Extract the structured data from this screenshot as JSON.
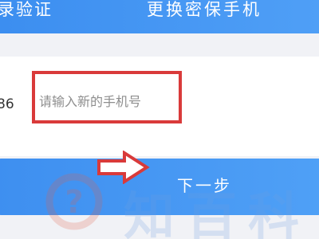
{
  "header": {
    "steps": [
      "录验证",
      "更换密保手机"
    ]
  },
  "form": {
    "country_code": "86",
    "phone_placeholder": "请输入新的手机号"
  },
  "next_button": {
    "label": "下一步"
  },
  "watermark": {
    "text": "知百科",
    "logo_glyph": "?"
  },
  "colors": {
    "header_blue": "#3c8ef0",
    "button_blue": "#4fa0f6",
    "annotation_red": "#d93a3a",
    "page_bg": "#f1f2f6"
  },
  "icons": {
    "annotation_arrow": "right-arrow-icon"
  }
}
